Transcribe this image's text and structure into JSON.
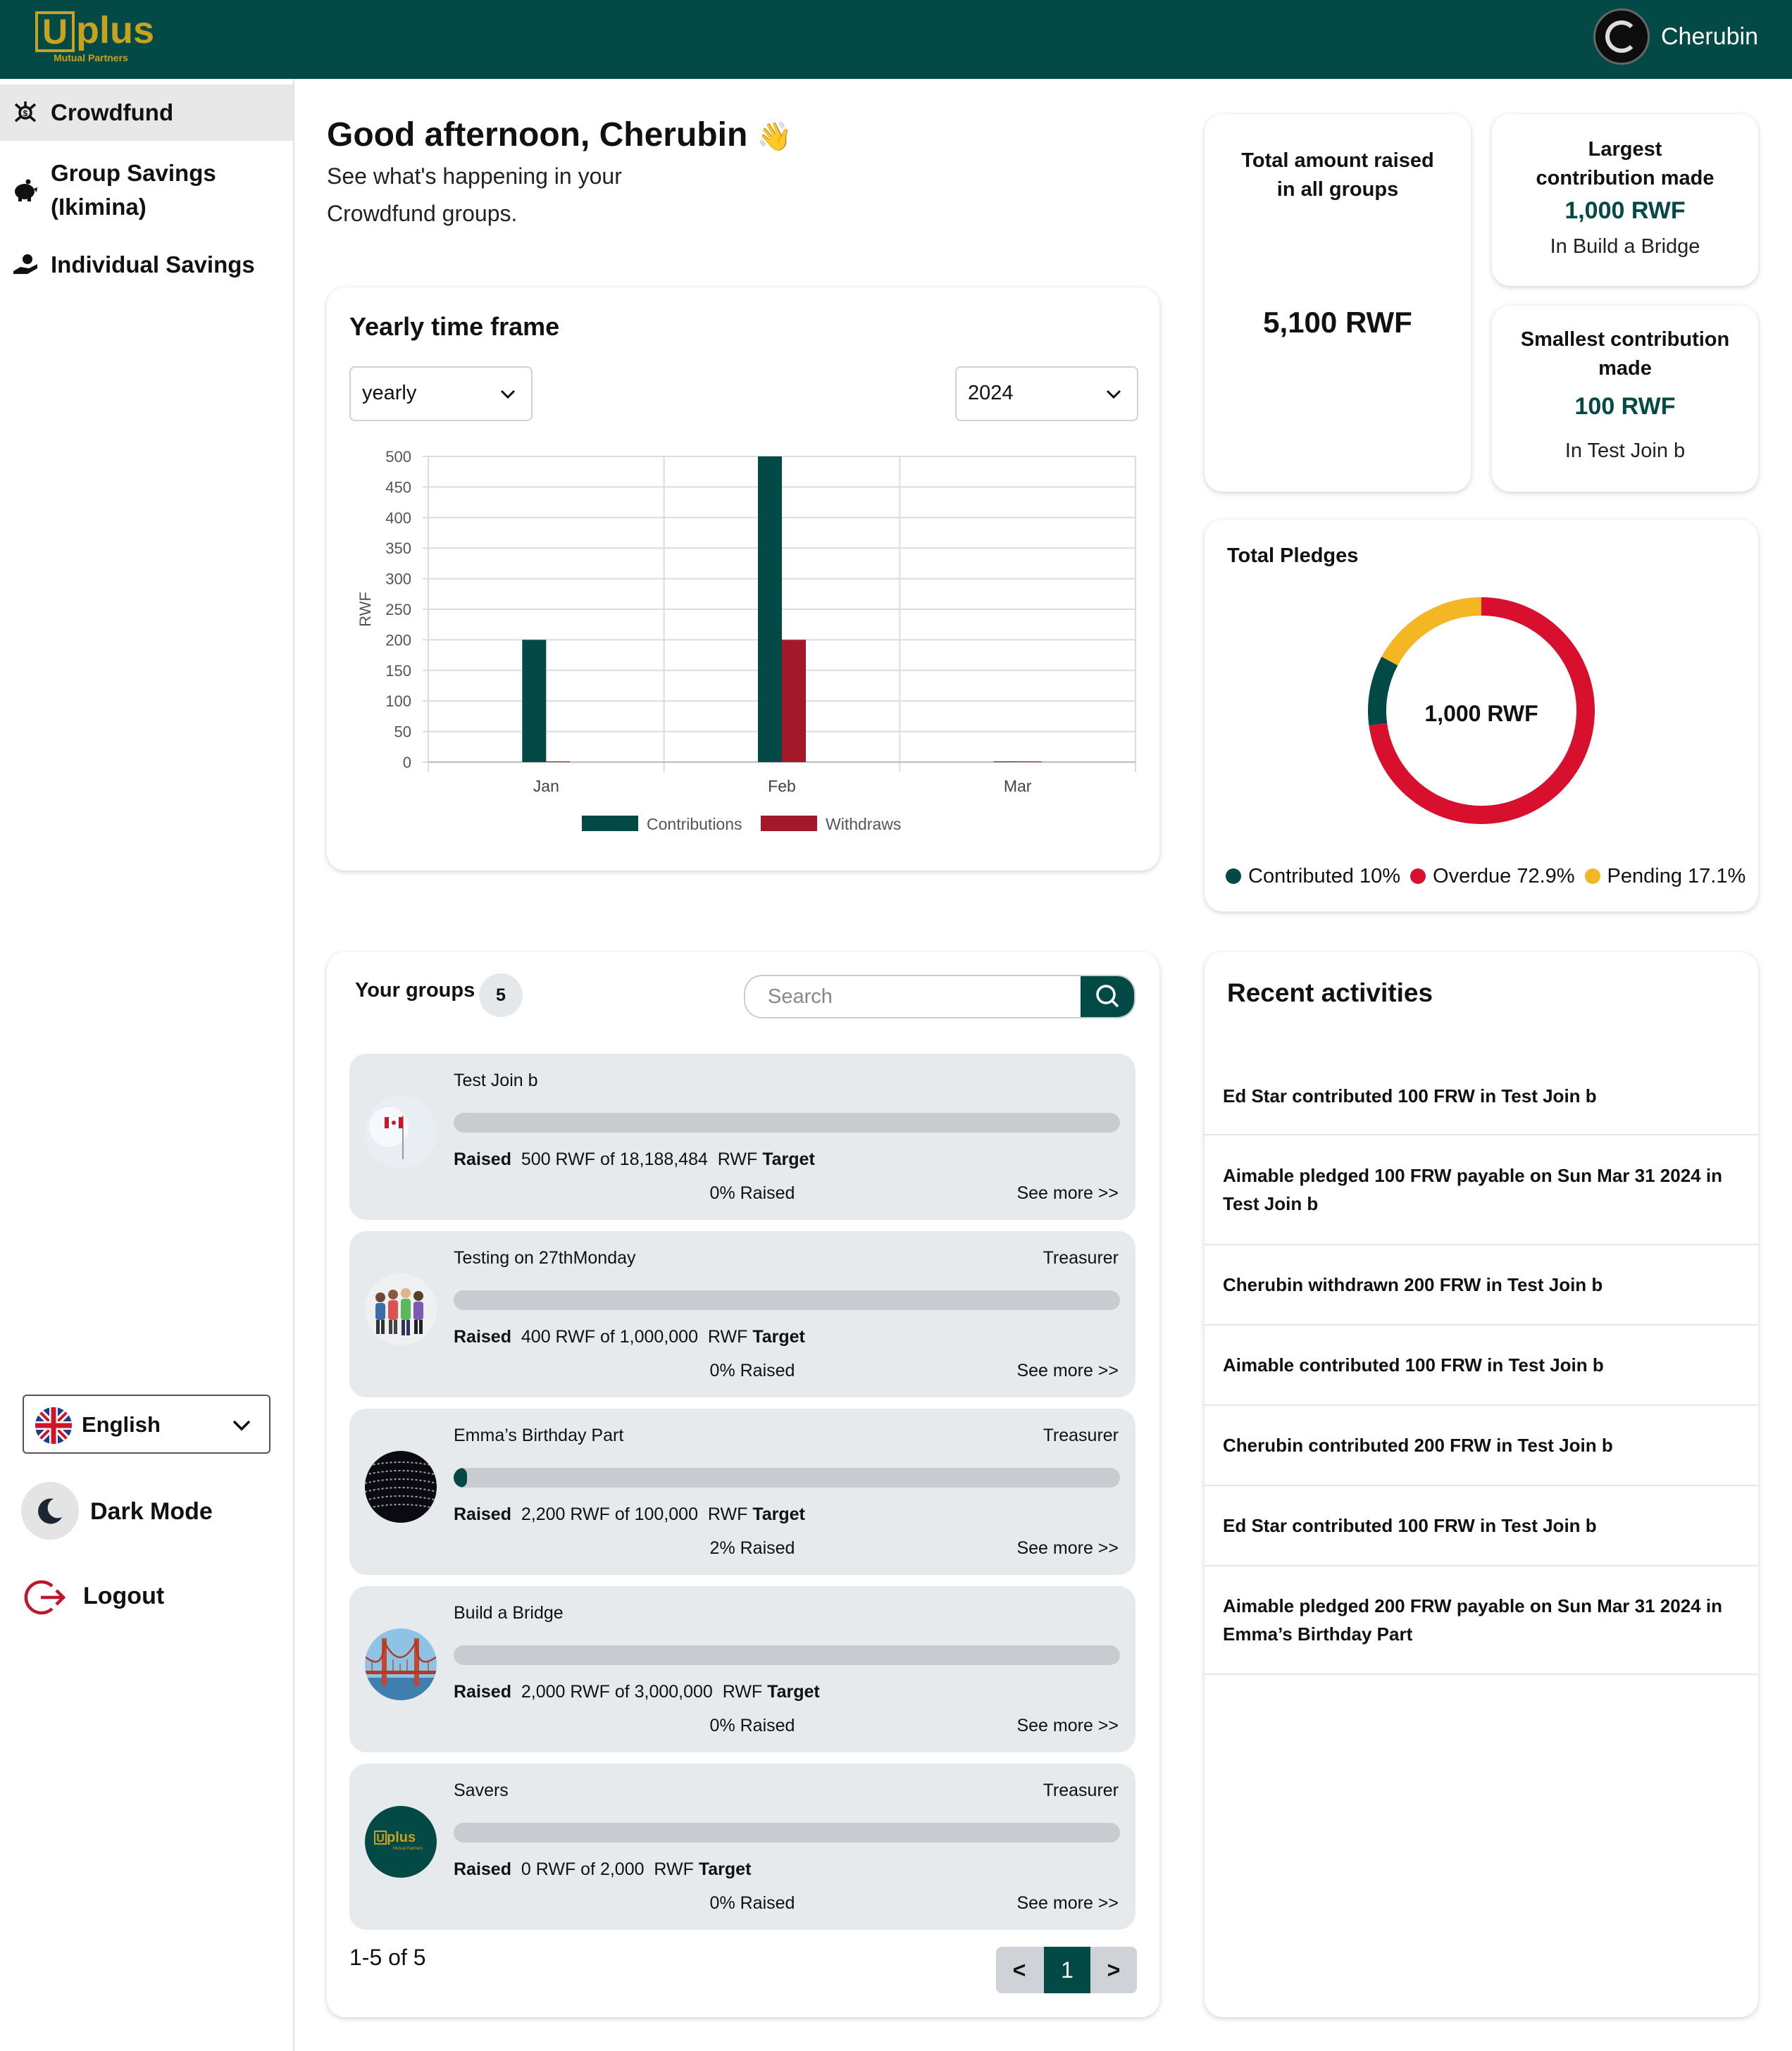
{
  "header": {
    "logo_text": "plus",
    "logo_letter": "U",
    "logo_sub": "Mutual Partners",
    "user_name": "Cherubin"
  },
  "sidebar": {
    "items": [
      {
        "label": "Crowdfund",
        "icon": "crowdfund-icon",
        "active": true
      },
      {
        "label": "Group Savings (Ikimina)",
        "icon": "piggy-bank-icon",
        "active": false
      },
      {
        "label": "Individual Savings",
        "icon": "hand-coin-icon",
        "active": false
      }
    ],
    "language": "English",
    "dark_mode": "Dark Mode",
    "logout": "Logout"
  },
  "greeting": {
    "title": "Good afternoon, Cherubin",
    "emoji": "👋",
    "subtitle": "See what's happening in your Crowdfund groups."
  },
  "chart_card": {
    "title": "Yearly time frame",
    "period": "yearly",
    "year": "2024"
  },
  "chart_data": {
    "type": "bar",
    "categories": [
      "Jan",
      "Feb",
      "Mar"
    ],
    "series": [
      {
        "name": "Contributions",
        "values": [
          200,
          500,
          0
        ],
        "color": "#034a46"
      },
      {
        "name": "Withdraws",
        "values": [
          0,
          200,
          0
        ],
        "color": "#a3182b"
      }
    ],
    "ylabel": "RWF",
    "ylim": [
      0,
      500
    ],
    "yticks": [
      "0",
      "50",
      "100",
      "150",
      "200",
      "250",
      "300",
      "350",
      "400",
      "450",
      "500"
    ],
    "grid": true,
    "legend": "bottom"
  },
  "stats": {
    "total": {
      "title": "Total amount raised in all groups",
      "value": "5,100 RWF"
    },
    "largest": {
      "title": "Largest contribution made",
      "value": "1,000 RWF",
      "group": "In Build a Bridge"
    },
    "smallest": {
      "title": "Smallest contribution made",
      "value": "100 RWF",
      "group": "In Test Join b"
    }
  },
  "pledges": {
    "title": "Total Pledges",
    "total": "1,000 RWF",
    "legend": [
      {
        "label": "Contributed 10%",
        "value": 10,
        "color": "#034a46"
      },
      {
        "label": "Overdue 72.9%",
        "value": 72.9,
        "color": "#d8102e"
      },
      {
        "label": "Pending 17.1%",
        "value": 17.1,
        "color": "#f4b623"
      }
    ]
  },
  "groups": {
    "title": "Your groups",
    "count": "5",
    "search_placeholder": "Search",
    "raised_label": "Raised",
    "target_label": "Target",
    "see_more": "See more >>",
    "items": [
      {
        "name": "Test Join b",
        "role": "",
        "amount": "500 RWF of 18,188,484",
        "currency": "RWF",
        "percent_text": "0% Raised",
        "progress": 0,
        "avatar": "flag-photo-icon"
      },
      {
        "name": "Testing on 27thMonday",
        "role": "Treasurer",
        "amount": "400 RWF of 1,000,000",
        "currency": "RWF",
        "percent_text": "0% Raised",
        "progress": 0,
        "avatar": "people-group-icon"
      },
      {
        "name": "Emma’s Birthday Part",
        "role": "Treasurer",
        "amount": "2,200 RWF of 100,000",
        "currency": "RWF",
        "percent_text": "2% Raised",
        "progress": 2,
        "avatar": "abstract-photo-icon"
      },
      {
        "name": "Build a Bridge",
        "role": "",
        "amount": "2,000 RWF of 3,000,000",
        "currency": "RWF",
        "percent_text": "0% Raised",
        "progress": 0,
        "avatar": "bridge-photo-icon"
      },
      {
        "name": "Savers",
        "role": "Treasurer",
        "amount": "0 RWF of 2,000",
        "currency": "RWF",
        "percent_text": "0% Raised",
        "progress": 0,
        "avatar": "uplus-logo-icon"
      }
    ],
    "range": "1-5 of 5",
    "pager": {
      "prev": "<",
      "page": "1",
      "next": ">"
    }
  },
  "activities": {
    "title": "Recent activities",
    "items": [
      "Ed Star contributed 100 FRW in Test Join b",
      "Aimable pledged 100 FRW payable on Sun Mar 31 2024 in Test Join b",
      "Cherubin withdrawn 200 FRW in Test Join b",
      "Aimable contributed 100 FRW in Test Join b",
      "Cherubin contributed 200 FRW in Test Join b",
      "Ed Star contributed 100 FRW in Test Join b",
      "Aimable pledged 200 FRW payable on Sun Mar 31 2024 in Emma’s Birthday Part"
    ]
  }
}
